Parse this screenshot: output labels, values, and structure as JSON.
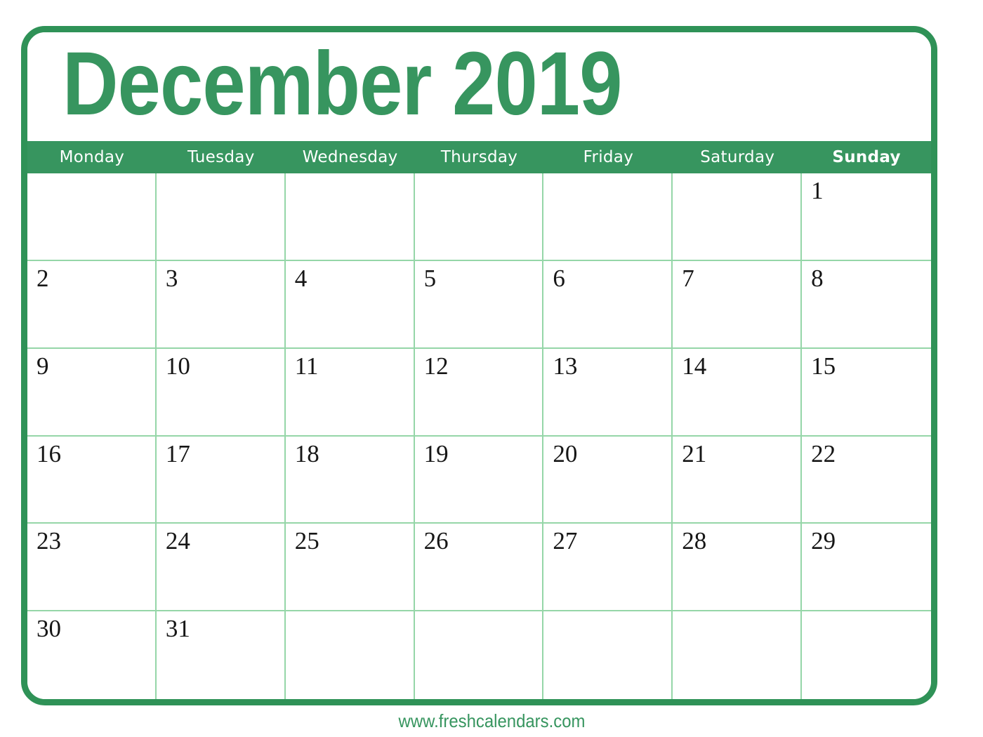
{
  "calendar": {
    "title": "December 2019",
    "month": "December",
    "year": "2019",
    "accent_color": "#37955f",
    "grid_line_color": "#95d6a8",
    "day_number_color": "#161616",
    "weekdays": [
      {
        "label": "Monday",
        "highlight": false
      },
      {
        "label": "Tuesday",
        "highlight": false
      },
      {
        "label": "Wednesday",
        "highlight": false
      },
      {
        "label": "Thursday",
        "highlight": false
      },
      {
        "label": "Friday",
        "highlight": false
      },
      {
        "label": "Saturday",
        "highlight": false
      },
      {
        "label": "Sunday",
        "highlight": true
      }
    ],
    "weeks": [
      [
        "",
        "",
        "",
        "",
        "",
        "",
        "1"
      ],
      [
        "2",
        "3",
        "4",
        "5",
        "6",
        "7",
        "8"
      ],
      [
        "9",
        "10",
        "11",
        "12",
        "13",
        "14",
        "15"
      ],
      [
        "16",
        "17",
        "18",
        "19",
        "20",
        "21",
        "22"
      ],
      [
        "23",
        "24",
        "25",
        "26",
        "27",
        "28",
        "29"
      ],
      [
        "30",
        "31",
        "",
        "",
        "",
        "",
        ""
      ]
    ]
  },
  "footer": {
    "website": "www.freshcalendars.com"
  }
}
